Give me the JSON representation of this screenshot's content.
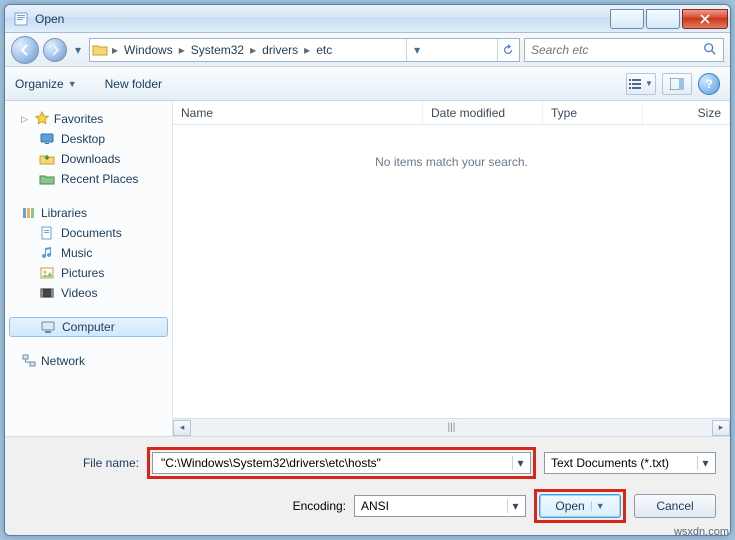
{
  "title": "Open",
  "nav": {
    "crumbs": [
      "Windows",
      "System32",
      "drivers",
      "etc"
    ],
    "search_placeholder": "Search etc"
  },
  "toolbar": {
    "organize": "Organize",
    "newfolder": "New folder"
  },
  "sidebar": {
    "favorites": "Favorites",
    "desktop": "Desktop",
    "downloads": "Downloads",
    "recent": "Recent Places",
    "libraries": "Libraries",
    "documents": "Documents",
    "music": "Music",
    "pictures": "Pictures",
    "videos": "Videos",
    "computer": "Computer",
    "network": "Network"
  },
  "columns": {
    "name": "Name",
    "date": "Date modified",
    "type": "Type",
    "size": "Size"
  },
  "empty_msg": "No items match your search.",
  "footer": {
    "filename_label": "File name:",
    "filename_value": "\"C:\\Windows\\System32\\drivers\\etc\\hosts\"",
    "filter_value": "Text Documents (*.txt)",
    "encoding_label": "Encoding:",
    "encoding_value": "ANSI",
    "open": "Open",
    "cancel": "Cancel"
  },
  "watermark": "wsxdn.com"
}
